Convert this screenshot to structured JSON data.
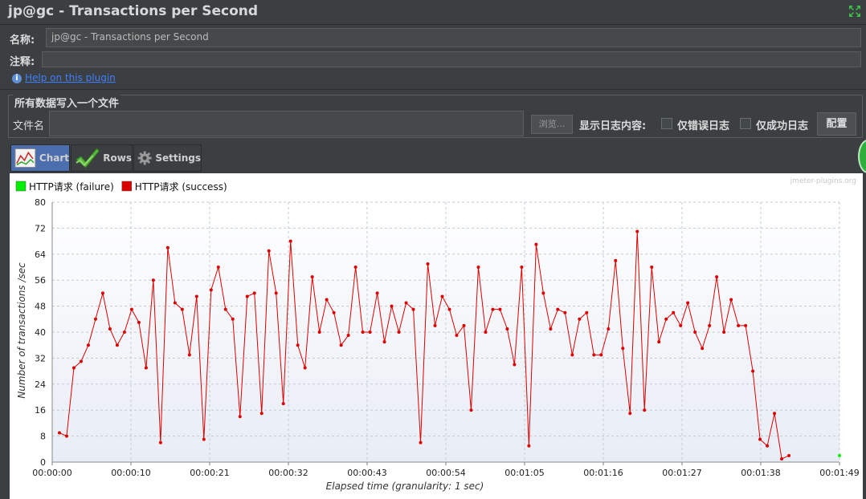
{
  "window": {
    "title": "jp@gc - Transactions per Second"
  },
  "form": {
    "name_label": "名称:",
    "name_value": "jp@gc - Transactions per Second",
    "comment_label": "注释:",
    "comment_value": "",
    "help_link": "Help on this plugin"
  },
  "file_group": {
    "title": "所有数据写入一个文件",
    "filename_label": "文件名",
    "filename_value": "",
    "browse_label": "浏览...",
    "log_display_label": "显示日志内容:",
    "errors_only_label": "仅错误日志",
    "success_only_label": "仅成功日志",
    "configure_label": "配置"
  },
  "tabs": [
    {
      "label": "Chart",
      "icon": "chart-icon",
      "selected": true
    },
    {
      "label": "Rows",
      "icon": "checkmark-icon",
      "selected": false
    },
    {
      "label": "Settings",
      "icon": "gear-icon",
      "selected": false
    }
  ],
  "chart_data": {
    "type": "line",
    "title": "",
    "watermark": "jmeter-plugins.org",
    "xlabel": "Elapsed time (granularity: 1 sec)",
    "ylabel": "Number of transactions /sec",
    "ylim": [
      0,
      80
    ],
    "xlim": [
      0,
      109
    ],
    "y_ticks": [
      "0",
      "8",
      "16",
      "24",
      "32",
      "40",
      "48",
      "56",
      "64",
      "72",
      "80"
    ],
    "x_ticks": [
      "00:00:00",
      "00:00:10",
      "00:00:21",
      "00:00:32",
      "00:00:43",
      "00:00:54",
      "00:01:05",
      "00:01:16",
      "00:01:27",
      "00:01:38",
      "00:01:49"
    ],
    "grid": true,
    "legend_position": "top-left",
    "series": [
      {
        "name": "HTTP请求 (failure)",
        "color": "#00ee00",
        "x": [
          109
        ],
        "y": [
          2
        ]
      },
      {
        "name": "HTTP请求 (success)",
        "color": "#dd0000",
        "x": [
          1,
          2,
          3,
          4,
          5,
          6,
          7,
          8,
          9,
          10,
          11,
          12,
          13,
          14,
          15,
          16,
          17,
          18,
          19,
          20,
          21,
          22,
          23,
          24,
          25,
          26,
          27,
          28,
          29,
          30,
          31,
          32,
          33,
          34,
          35,
          36,
          37,
          38,
          39,
          40,
          41,
          42,
          43,
          44,
          45,
          46,
          47,
          48,
          49,
          50,
          51,
          52,
          53,
          54,
          55,
          56,
          57,
          58,
          59,
          60,
          61,
          62,
          63,
          64,
          65,
          66,
          67,
          68,
          69,
          70,
          71,
          72,
          73,
          74,
          75,
          76,
          77,
          78,
          79,
          80,
          81,
          82,
          83,
          84,
          85,
          86,
          87,
          88,
          89,
          90,
          91,
          92,
          93,
          94,
          95,
          96,
          97,
          98,
          99,
          100,
          101,
          102
        ],
        "y": [
          9,
          8,
          29,
          31,
          36,
          44,
          52,
          41,
          36,
          40,
          47,
          43,
          29,
          56,
          6,
          66,
          49,
          47,
          33,
          51,
          7,
          53,
          60,
          47,
          44,
          14,
          51,
          52,
          15,
          65,
          52,
          18,
          68,
          36,
          29,
          57,
          40,
          50,
          46,
          36,
          39,
          60,
          40,
          40,
          52,
          37,
          48,
          40,
          49,
          47,
          6,
          61,
          42,
          51,
          47,
          39,
          42,
          16,
          60,
          40,
          47,
          47,
          41,
          30,
          60,
          5,
          67,
          52,
          41,
          47,
          46,
          33,
          44,
          46,
          33,
          33,
          41,
          62,
          35,
          15,
          71,
          16,
          60,
          37,
          44,
          46,
          42,
          49,
          40,
          35,
          42,
          57,
          40,
          50,
          42,
          42,
          28,
          7,
          5,
          15,
          1,
          2
        ]
      }
    ]
  }
}
